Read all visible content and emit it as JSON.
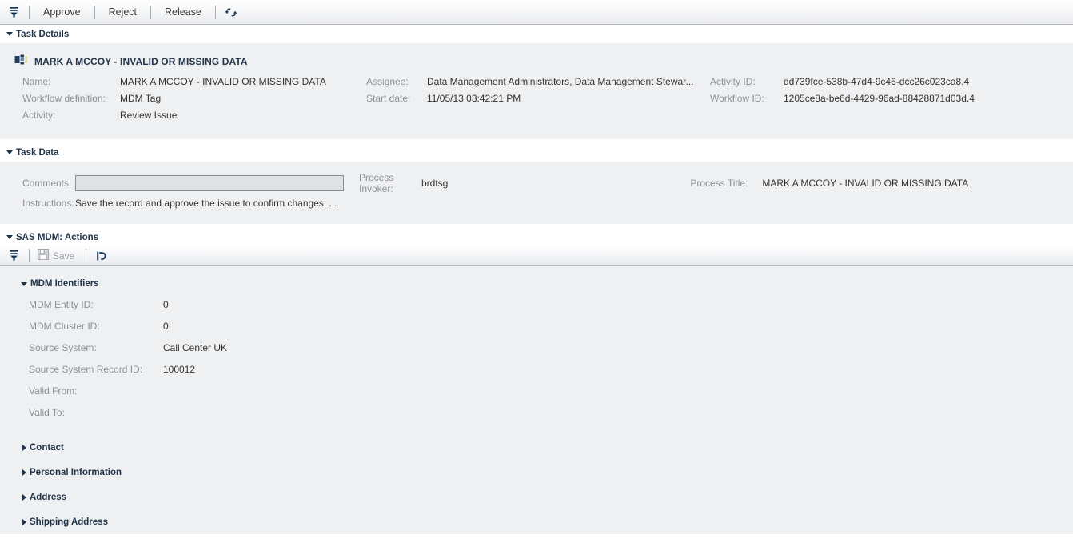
{
  "toolbar": {
    "menu_icon": "filter-dropdown-icon",
    "buttons": [
      {
        "label": "Approve"
      },
      {
        "label": "Reject"
      },
      {
        "label": "Release"
      }
    ],
    "refresh_icon": "refresh-icon"
  },
  "task_details": {
    "header": "Task Details",
    "title": "MARK A MCCOY - INVALID OR MISSING DATA",
    "title_icon": "entity-records-icon",
    "fields_left": [
      {
        "label": "Name:",
        "value": "MARK A MCCOY - INVALID OR MISSING DATA"
      },
      {
        "label": "Workflow definition:",
        "value": "MDM Tag"
      },
      {
        "label": "Activity:",
        "value": "Review Issue"
      }
    ],
    "fields_middle": [
      {
        "label": "Assignee:",
        "value": "Data Management Administrators, Data Management Stewar..."
      },
      {
        "label": "Start date:",
        "value": "11/05/13 03:42:21 PM"
      }
    ],
    "fields_right": [
      {
        "label": "Activity ID:",
        "value": "dd739fce-538b-47d4-9c46-dcc26c023ca8.4"
      },
      {
        "label": "Workflow ID:",
        "value": "1205ce8a-be6d-4429-96ad-88428871d03d.4"
      }
    ]
  },
  "task_data": {
    "header": "Task Data",
    "comments_label": "Comments:",
    "comments_value": "",
    "comments_placeholder": "",
    "instructions_label": "Instructions:",
    "instructions_value": "Save the record and approve the issue to confirm changes. ...",
    "process_invoker_label": "Process Invoker:",
    "process_invoker_value": "brdtsg",
    "process_title_label": "Process Title:",
    "process_title_value": "MARK A MCCOY - INVALID OR MISSING DATA"
  },
  "actions": {
    "header": "SAS MDM: Actions",
    "menu_icon": "filter-dropdown-icon",
    "save_label": "Save",
    "save_icon": "save-disk-icon",
    "undo_icon": "undo-arrow-icon"
  },
  "mdm_identifiers": {
    "header": "MDM Identifiers",
    "fields": [
      {
        "label": "MDM Entity ID:",
        "value": "0"
      },
      {
        "label": "MDM Cluster ID:",
        "value": "0"
      },
      {
        "label": "Source System:",
        "value": "Call Center UK"
      },
      {
        "label": "Source System Record ID:",
        "value": "100012"
      },
      {
        "label": "Valid From:",
        "value": ""
      },
      {
        "label": "Valid To:",
        "value": ""
      }
    ]
  },
  "collapsed_sections": [
    {
      "label": "Contact"
    },
    {
      "label": "Personal Information"
    },
    {
      "label": "Address"
    },
    {
      "label": "Shipping Address"
    }
  ],
  "colors": {
    "panel_bg": "#eff0f2",
    "header_text": "#1f3247",
    "label_text": "#8d9096",
    "accent": "#1b3a5c"
  }
}
